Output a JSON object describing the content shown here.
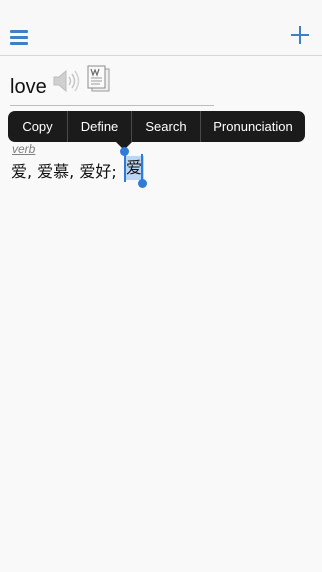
{
  "entry": {
    "headword": "love",
    "part_of_speech": "verb",
    "translation_prefix": "爱, 爱慕, 爱好;",
    "selected_text": "爱"
  },
  "popup_menu": {
    "items": [
      "Copy",
      "Define",
      "Search",
      "Pronunciation"
    ]
  },
  "icons": {
    "menu": "hamburger-menu-icon",
    "add": "plus-icon",
    "speaker": "speaker-icon",
    "document": "word-document-icon"
  },
  "colors": {
    "accent": "#3e7fc6",
    "selection": "#bcd6f2",
    "popup_background": "#1b1b1b"
  }
}
